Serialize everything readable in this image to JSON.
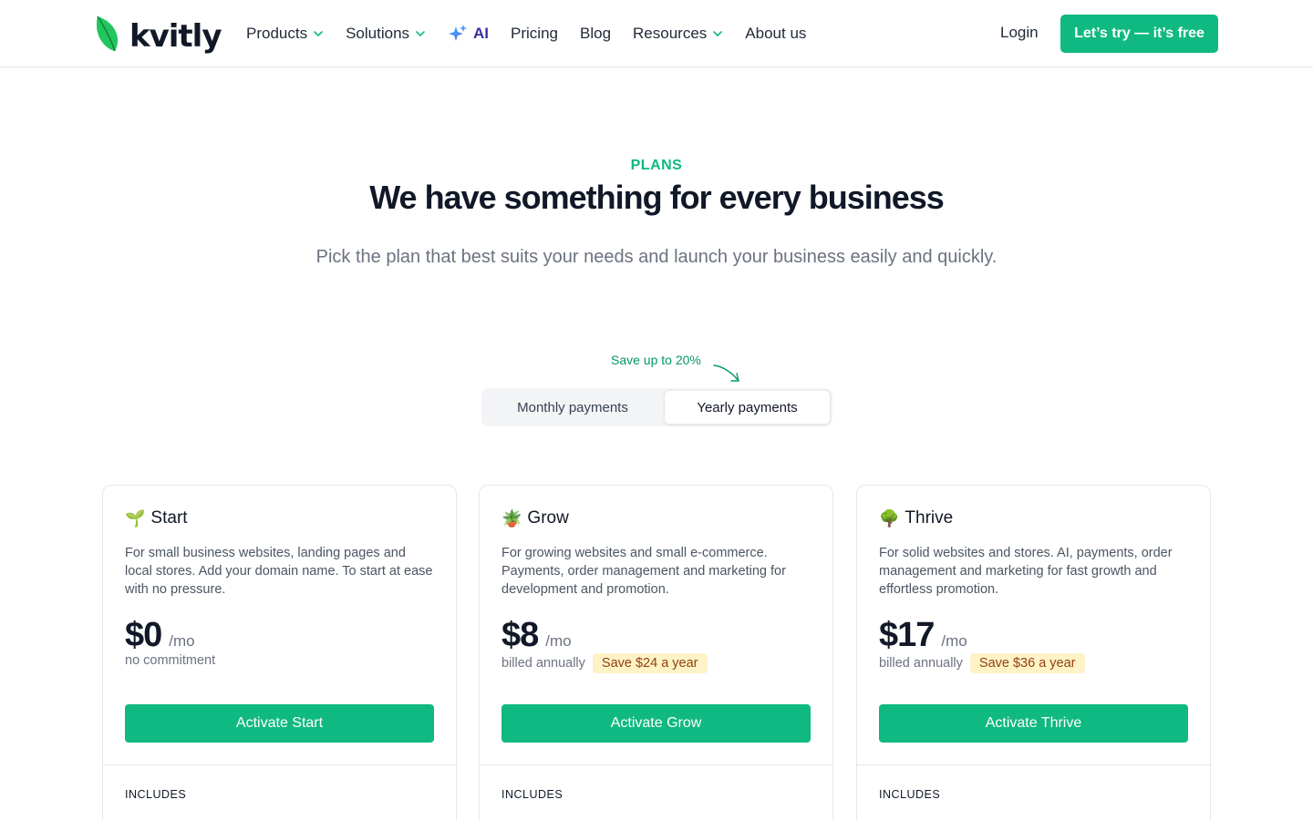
{
  "header": {
    "logo_text": "kvitly",
    "nav": [
      {
        "label": "Products",
        "dropdown": true
      },
      {
        "label": "Solutions",
        "dropdown": true
      },
      {
        "label": "AI",
        "dropdown": false
      },
      {
        "label": "Pricing",
        "dropdown": false
      },
      {
        "label": "Blog",
        "dropdown": false
      },
      {
        "label": "Resources",
        "dropdown": true
      },
      {
        "label": "About us",
        "dropdown": false
      }
    ],
    "login_label": "Login",
    "cta_label": "Let’s try — it’s free"
  },
  "hero": {
    "eyebrow": "PLANS",
    "headline": "We have something for every business",
    "subheadline": "Pick the plan that best suits your needs and launch your business easily and quickly."
  },
  "billing_toggle": {
    "note": "Save up to 20%",
    "options": [
      "Monthly payments",
      "Yearly payments"
    ],
    "selected": "Yearly payments"
  },
  "plans": [
    {
      "emoji": "🌱",
      "name": "Start",
      "description": "For small business websites, landing pages and local stores. Add your domain name. To start at ease with no pressure.",
      "price": "$0",
      "per": "/mo",
      "billing": "no commitment",
      "save": "",
      "button": "Activate Start",
      "includes": "INCLUDES"
    },
    {
      "emoji": "🪴",
      "name": "Grow",
      "description": "For growing websites and small e-commerce. Payments, order management and marketing for development and promotion.",
      "price": "$8",
      "per": "/mo",
      "billing": "billed annually",
      "save": "Save $24 a year",
      "button": "Activate Grow",
      "includes": "INCLUDES"
    },
    {
      "emoji": "🌳",
      "name": "Thrive",
      "description": "For solid websites and stores. AI, payments, order management and marketing for fast growth and effortless promotion.",
      "price": "$17",
      "per": "/mo",
      "billing": "billed annually",
      "save": "Save $36 a year",
      "button": "Activate Thrive",
      "includes": "INCLUDES"
    }
  ],
  "colors": {
    "brand": "#10b981",
    "ai_accent": "#3730a3",
    "badge_bg": "#fef3c7",
    "badge_text": "#92400e"
  },
  "icons": [
    "leaf-logo-icon",
    "chevron-down-icon",
    "sparkles-icon",
    "curved-arrow-icon"
  ]
}
